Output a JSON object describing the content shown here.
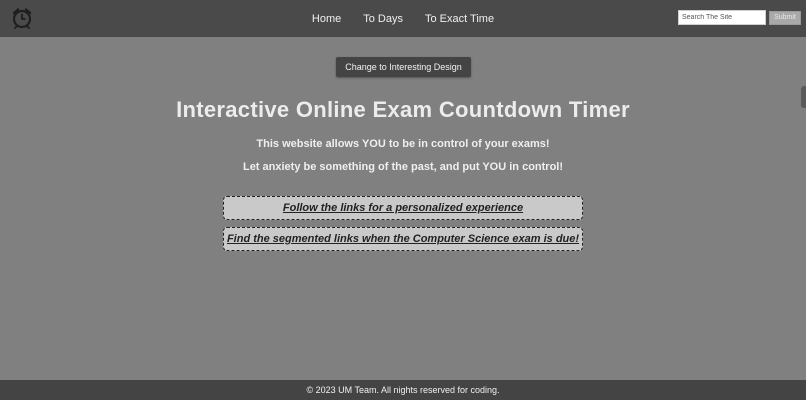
{
  "header": {
    "logo_icon": "alarm-clock-icon",
    "nav": [
      {
        "label": "Home"
      },
      {
        "label": "To Days"
      },
      {
        "label": "To Exact Time"
      }
    ],
    "search": {
      "placeholder": "Search The Site",
      "value": "",
      "submit_label": "Submit"
    }
  },
  "main": {
    "theme_button_label": "Change to Interesting Design",
    "title": "Interactive Online Exam Countdown Timer",
    "tagline_1": "This website allows YOU to be in control of your exams!",
    "tagline_2": "Let anxiety be something of the past, and put YOU in control!",
    "links": [
      {
        "label": "Follow the links for a personalized experience"
      },
      {
        "label": "Find the segmented links when the Computer Science exam is due!"
      }
    ]
  },
  "footer": {
    "text": "© 2023 UM Team. All nights reserved for coding."
  },
  "colors": {
    "background": "#808080",
    "header": "#4a4a4a",
    "footer": "#444444",
    "link_box": "#c9c9c9"
  }
}
